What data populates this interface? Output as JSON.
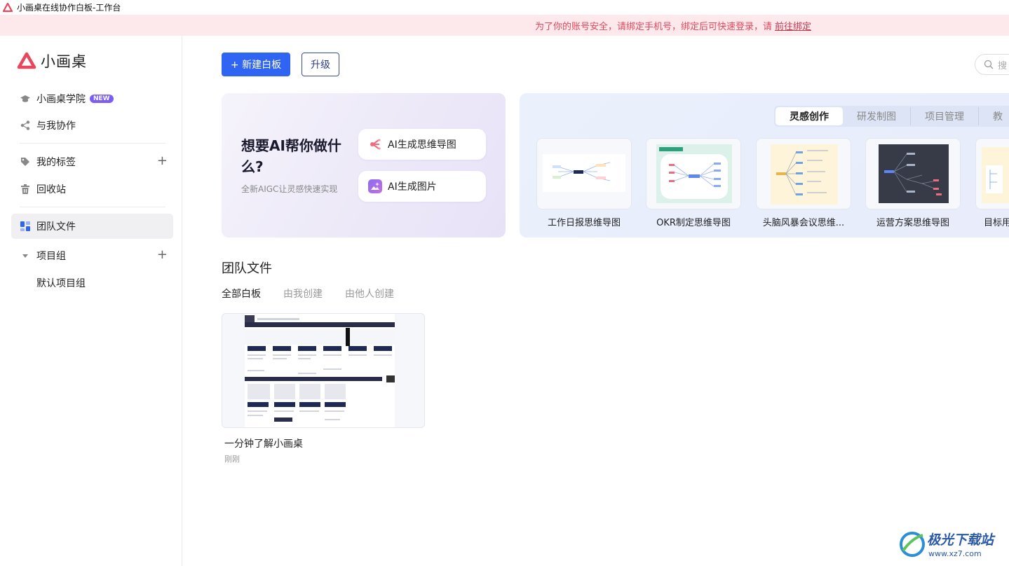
{
  "window": {
    "title": "小画桌在线协作白板-工作台"
  },
  "notice": {
    "text": "为了你的账号安全，请绑定手机号，绑定后可快速登录，请",
    "link": "前往绑定"
  },
  "brand": {
    "name": "小画桌",
    "color": "#e9475d"
  },
  "sidebar": {
    "academy": {
      "label": "小画桌学院",
      "badge": "NEW"
    },
    "collab": {
      "label": "与我协作"
    },
    "tags": {
      "label": "我的标签",
      "add": "+"
    },
    "trash": {
      "label": "回收站"
    },
    "team": {
      "label": "团队文件"
    },
    "project_group": {
      "label": "项目组",
      "add": "+"
    },
    "default_group": {
      "label": "默认项目组"
    }
  },
  "toolbar": {
    "new_label": "+ 新建白板",
    "upgrade_label": "升级",
    "search_placeholder": "搜"
  },
  "ai": {
    "title": "想要AI帮你做什么?",
    "subtitle": "全新AIGC让灵感快速实现",
    "mindmap_label": "AI生成思维导图",
    "image_label": "AI生成图片"
  },
  "templates": {
    "tabs": [
      "灵感创作",
      "研发制图",
      "项目管理",
      "教"
    ],
    "items": [
      {
        "name": "工作日报思维导图"
      },
      {
        "name": "OKR制定思维导图"
      },
      {
        "name": "头脑风暴会议思维..."
      },
      {
        "name": "运营方案思维导图"
      },
      {
        "name": "目标用"
      }
    ]
  },
  "team_files": {
    "title": "团队文件",
    "filters": [
      "全部白板",
      "由我创建",
      "由他人创建"
    ],
    "files": [
      {
        "name": "一分钟了解小画桌",
        "time": "刚刚"
      }
    ]
  },
  "watermark": {
    "text": "极光下载站",
    "url": "www.xz7.com"
  },
  "colors": {
    "primary": "#3064f2",
    "notice_bg": "#fde8eb",
    "notice_text": "#e04a5f",
    "badge": "#7b5cf5"
  }
}
